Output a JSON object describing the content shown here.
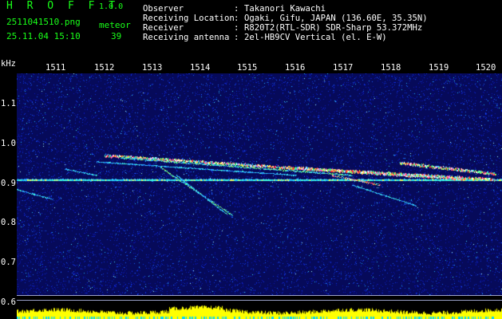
{
  "app": {
    "title": "H R O F F T",
    "version": "1.0.0"
  },
  "capture": {
    "filename": "2511041510.png",
    "datetime": "25.11.04 15:10",
    "meteor_label": "meteor",
    "meteor_count": "39"
  },
  "info": [
    {
      "label": "Observer",
      "value": "Takanori Kawachi"
    },
    {
      "label": "Receiving Location",
      "value": "Ogaki, Gifu, JAPAN (136.60E, 35.35N)"
    },
    {
      "label": "Receiver",
      "value": "R820T2(RTL-SDR) SDR-Sharp 53.372MHz"
    },
    {
      "label": "Receiving antenna",
      "value": "2el-HB9CV Vertical (el. E-W)"
    }
  ],
  "colon": ":",
  "spectrogram": {
    "y_unit_label": "kHz",
    "time_ticks": [
      "1511",
      "1512",
      "1513",
      "1514",
      "1515",
      "1516",
      "1517",
      "1518",
      "1519",
      "1520"
    ],
    "freq_ticks": [
      "1.1",
      "1.0",
      "0.9",
      "0.8",
      "0.7",
      "0.6"
    ]
  },
  "colors": {
    "background": "#000000",
    "header_green": "#19ff19",
    "noise_base": "#0a0f96",
    "activity_yellow": "#ffff00",
    "activity_cyan": "#00d8ff"
  }
}
